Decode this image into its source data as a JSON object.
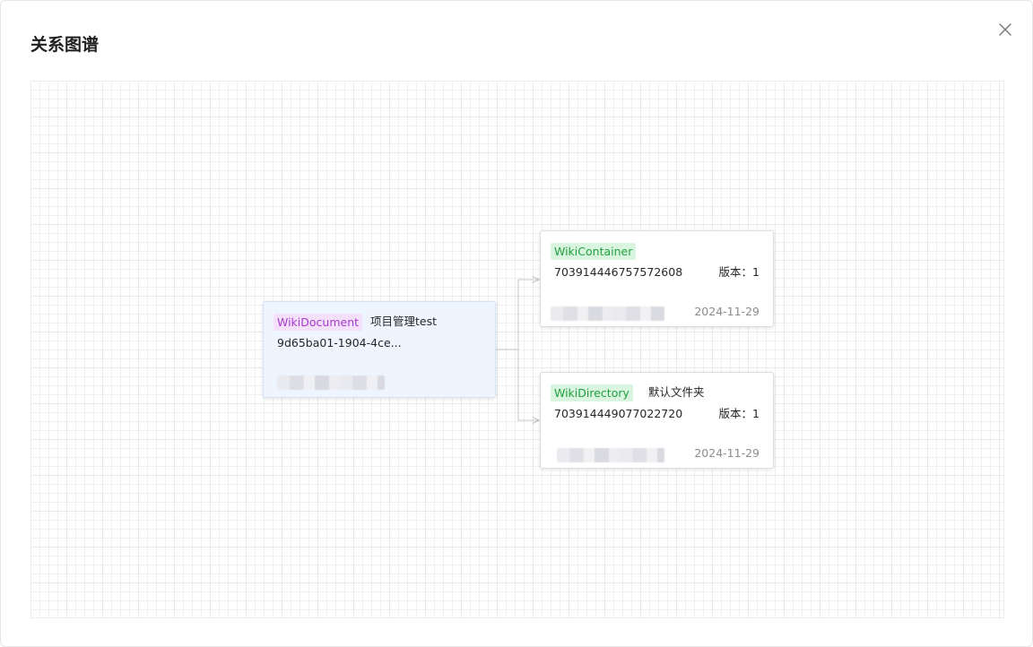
{
  "modal": {
    "title": "关系图谱",
    "close_icon": "close-icon"
  },
  "graph": {
    "root": {
      "type": "WikiDocument",
      "name": "项目管理test",
      "id": "9d65ba01-1904-4ce...",
      "type_color": "#a43bcb"
    },
    "children": [
      {
        "type": "WikiContainer",
        "name": "",
        "id": "703914446757572608",
        "version": "版本：1",
        "date": "2024-11-29",
        "type_color": "#22a03f"
      },
      {
        "type": "WikiDirectory",
        "name": "默认文件夹",
        "id": "703914449077022720",
        "version": "版本：1",
        "date": "2024-11-29",
        "type_color": "#22a03f"
      }
    ]
  }
}
